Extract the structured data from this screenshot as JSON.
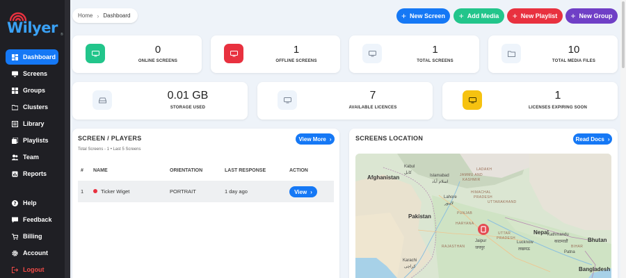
{
  "app": {
    "logo_text": "Wilyer",
    "logo_tm": "®"
  },
  "colors": {
    "accent": "#1578f5",
    "green": "#22c58b",
    "red": "#e8313f",
    "purple": "#6f3fc6",
    "yellow": "#f6c210",
    "sidebar": "#1f1f24"
  },
  "sidebar": {
    "items": [
      {
        "label": "Dashboard",
        "icon": "dashboard-icon",
        "active": true
      },
      {
        "label": "Screens",
        "icon": "screen-icon"
      },
      {
        "label": "Groups",
        "icon": "grid-icon"
      },
      {
        "label": "Clusters",
        "icon": "folder-icon"
      },
      {
        "label": "Library",
        "icon": "library-icon"
      },
      {
        "label": "Playlists",
        "icon": "playlist-icon"
      },
      {
        "label": "Team",
        "icon": "team-icon"
      },
      {
        "label": "Reports",
        "icon": "report-icon"
      },
      {
        "label": "Help",
        "icon": "help-icon"
      },
      {
        "label": "Feedback",
        "icon": "feedback-icon"
      },
      {
        "label": "Billing",
        "icon": "cart-icon"
      },
      {
        "label": "Account",
        "icon": "gear-icon"
      },
      {
        "label": "Logout",
        "icon": "logout-icon"
      }
    ]
  },
  "breadcrumb": {
    "home": "Home",
    "current": "Dashboard"
  },
  "toolbar": {
    "new_screen": "New Screen",
    "add_media": "Add Media",
    "new_playlist": "New Playlist",
    "new_group": "New Group"
  },
  "stats": {
    "online_screens": {
      "value": "0",
      "label": "ONLINE SCREENS"
    },
    "offline_screens": {
      "value": "1",
      "label": "OFFLINE SCREENS"
    },
    "total_screens": {
      "value": "1",
      "label": "TOTAL SCREENS"
    },
    "total_media": {
      "value": "10",
      "label": "TOTAL MEDIA FILES"
    },
    "storage": {
      "value": "0.01 GB",
      "label": "STORAGE USED"
    },
    "licences": {
      "value": "7",
      "label": "AVAILABLE LICENCES"
    },
    "expiring": {
      "value": "1",
      "label": "LICENSES EXPIRING SOON"
    }
  },
  "players": {
    "title": "SCREEN / PLAYERS",
    "view_more": "View More",
    "subtitle": "Total Screens - 1  •  Last 5 Screens",
    "columns": [
      "#",
      "NAME",
      "ORIENTATION",
      "LAST RESPONSE",
      "ACTION"
    ],
    "rows": [
      {
        "index": "1",
        "name": "Ticker Wiget",
        "orientation": "PORTRAIT",
        "last_response": "1 day ago",
        "action": "View",
        "status_color": "#e8313f"
      }
    ]
  },
  "location": {
    "title": "SCREENS LOCATION",
    "read_docs": "Read Docs",
    "map_labels": {
      "afghanistan": "Afghanistan",
      "pakistan": "Pakistan",
      "nepal": "Nepal",
      "bhutan": "Bhutan",
      "bangladesh": "Bangladesh",
      "kabul": "Kabul",
      "kabul_local": "كابل",
      "islamabad": "Islamabad",
      "islamabad_local": "اسلام آباد",
      "lahore": "Lahore",
      "lahore_local": "لاہور",
      "karachi": "Karachi",
      "karachi_local": "کراچی",
      "jaipur": "Jaipur",
      "jaipur_local": "जयपुर",
      "lucknow": "Lucknow",
      "lucknow_local": "लखनऊ",
      "kathmandu": "Kathmandu",
      "kathmandu_local": "काठमाडौं",
      "patna": "Patna",
      "jammu": "JAMMU AND",
      "kashmir": "KASHMIR",
      "ladakh": "LADAKH",
      "himachal": "HIMACHAL",
      "pradesh": "PRADESH",
      "uttarakhand": "UTTARAKHAND",
      "punjab": "PUNJAB",
      "haryana": "HARYANA",
      "uttar": "UTTAR",
      "pradesh2": "PRADESH",
      "rajasthan": "RAJASTHAN",
      "bihar": "BIHAR"
    }
  }
}
